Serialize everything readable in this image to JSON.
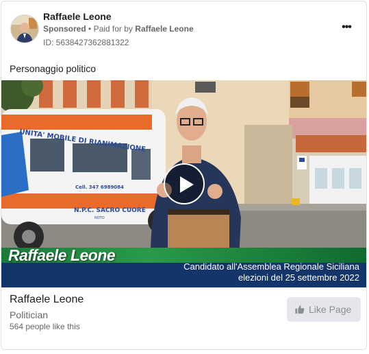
{
  "header": {
    "page_name": "Raffaele Leone",
    "sponsored_label": "Sponsored",
    "separator": "•",
    "paid_for_prefix": "Paid for by",
    "paid_for_name": "Raffaele Leone",
    "ad_id": "ID: 5638427362881322",
    "more_menu": "•••"
  },
  "post": {
    "text": "Personaggio politico"
  },
  "video": {
    "ambulance_text_1": "UNITA' MOBILE DI RIANIMAZIONE",
    "ambulance_text_2": "Cell. 347 6989084",
    "ambulance_text_3": "N.P.C. SACRO CUORE",
    "ambulance_text_4": "NOTO",
    "overlay_name": "Raffaele Leone",
    "overlay_caption_line1": "Candidato all'Assemblea Regionale Siciliana",
    "overlay_caption_line2": "elezioni del 25 settembre 2022",
    "colors": {
      "green_band": "#1a7a3a",
      "blue_band": "#13356a"
    }
  },
  "footer": {
    "page_name": "Raffaele Leone",
    "category": "Politician",
    "likes_text": "564 people like this",
    "like_button_label": "Like Page",
    "like_button_icon": "thumbs-up-icon"
  }
}
